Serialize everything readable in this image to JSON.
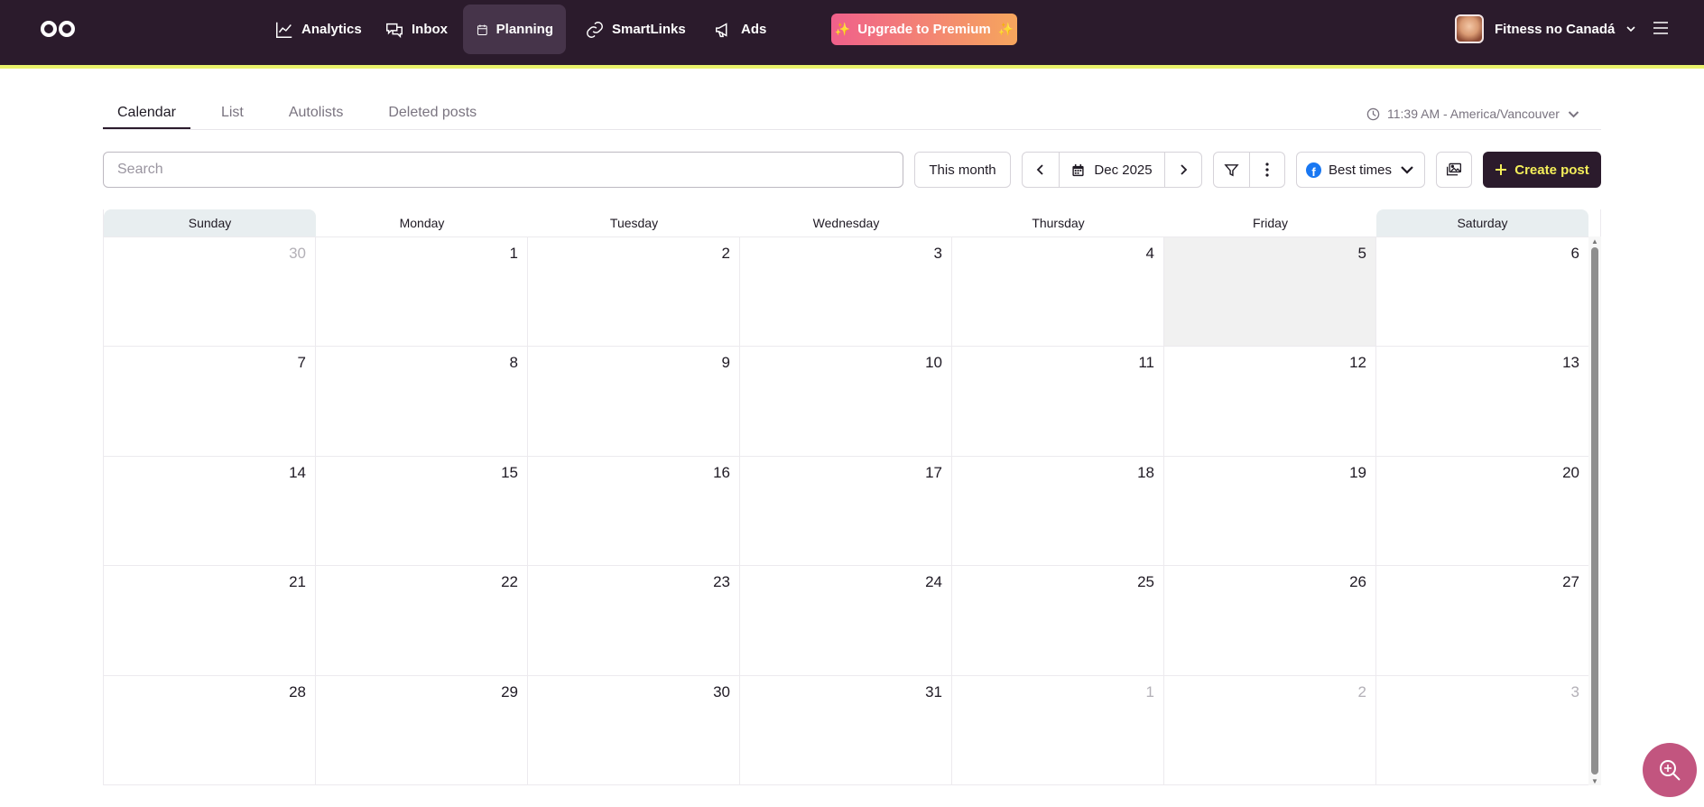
{
  "nav": {
    "logo_icon": "infinity-logo-icon",
    "items": [
      {
        "label": "Analytics",
        "icon": "chart-line-icon"
      },
      {
        "label": "Inbox",
        "icon": "chat-bubbles-icon"
      },
      {
        "label": "Planning",
        "icon": "calendar-icon",
        "active": true
      },
      {
        "label": "SmartLinks",
        "icon": "link-icon"
      },
      {
        "label": "Ads",
        "icon": "megaphone-icon"
      }
    ],
    "premium_label": "Upgrade to Premium",
    "account_name": "Fitness no Canadá",
    "colors": {
      "bar": "#2b1b2c",
      "accent": "#e9f26b"
    }
  },
  "tabs": [
    "Calendar",
    "List",
    "Autolists",
    "Deleted posts"
  ],
  "active_tab": "Calendar",
  "timezone": "11:39 AM - America/Vancouver",
  "toolbar": {
    "search_placeholder": "Search",
    "this_month": "This month",
    "current_month": "Dec 2025",
    "best_times": "Best times",
    "create_post": "Create post"
  },
  "calendar": {
    "weekdays": [
      "Sunday",
      "Monday",
      "Tuesday",
      "Wednesday",
      "Thursday",
      "Friday",
      "Saturday"
    ],
    "weeks": [
      [
        {
          "d": "30",
          "out": true
        },
        {
          "d": "1"
        },
        {
          "d": "2"
        },
        {
          "d": "3"
        },
        {
          "d": "4"
        },
        {
          "d": "5",
          "today": true
        },
        {
          "d": "6"
        }
      ],
      [
        {
          "d": "7"
        },
        {
          "d": "8"
        },
        {
          "d": "9"
        },
        {
          "d": "10"
        },
        {
          "d": "11"
        },
        {
          "d": "12"
        },
        {
          "d": "13"
        }
      ],
      [
        {
          "d": "14"
        },
        {
          "d": "15"
        },
        {
          "d": "16"
        },
        {
          "d": "17"
        },
        {
          "d": "18"
        },
        {
          "d": "19"
        },
        {
          "d": "20"
        }
      ],
      [
        {
          "d": "21"
        },
        {
          "d": "22"
        },
        {
          "d": "23"
        },
        {
          "d": "24"
        },
        {
          "d": "25"
        },
        {
          "d": "26"
        },
        {
          "d": "27"
        }
      ],
      [
        {
          "d": "28"
        },
        {
          "d": "29"
        },
        {
          "d": "30"
        },
        {
          "d": "31"
        },
        {
          "d": "1",
          "out": true
        },
        {
          "d": "2",
          "out": true
        },
        {
          "d": "3",
          "out": true
        }
      ]
    ]
  }
}
